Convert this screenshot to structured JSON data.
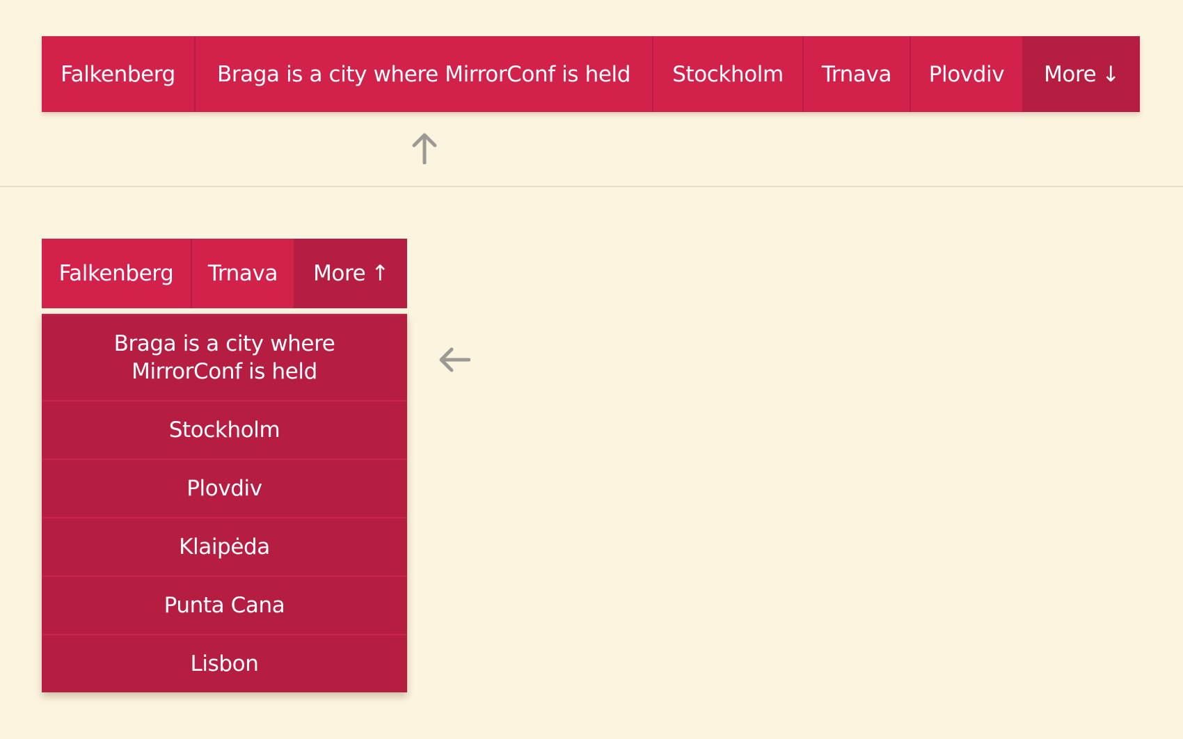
{
  "top_nav": {
    "items": [
      {
        "label": "Falkenberg"
      },
      {
        "label": "Braga is a city where MirrorConf is held"
      },
      {
        "label": "Stockholm"
      },
      {
        "label": "Trnava"
      },
      {
        "label": "Plovdiv"
      }
    ],
    "more_label": "More",
    "more_icon": "↓"
  },
  "bottom_nav": {
    "items": [
      {
        "label": "Falkenberg"
      },
      {
        "label": "Trnava"
      }
    ],
    "more_label": "More",
    "more_icon": "↑"
  },
  "dropdown": {
    "items": [
      {
        "label": "Braga is a city where MirrorConf is held"
      },
      {
        "label": "Stockholm"
      },
      {
        "label": "Plovdiv"
      },
      {
        "label": "Klaipėda"
      },
      {
        "label": "Punta Cana"
      },
      {
        "label": "Lisbon"
      }
    ]
  },
  "colors": {
    "background": "#fbf4df",
    "nav": "#d2224c",
    "nav_more": "#b51e42",
    "annotation_arrow": "#9c9a93"
  }
}
